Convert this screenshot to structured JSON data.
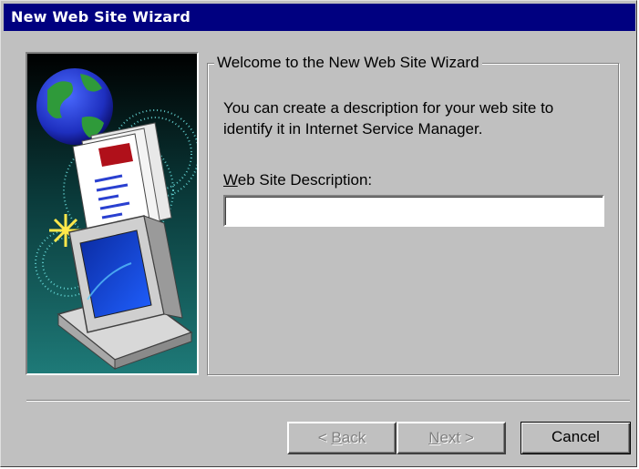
{
  "window": {
    "title": "New Web Site Wizard"
  },
  "illustration": {
    "icon": "wizard-illustration-globe-document-computer"
  },
  "group": {
    "legend": "Welcome to the New Web Site Wizard",
    "intro": "You can create a description for your web site to identify it in Internet Service Manager.",
    "field_label_accel": "W",
    "field_label_rest": "eb Site Description:",
    "field_value": ""
  },
  "buttons": {
    "back_prefix": "< ",
    "back_accel": "B",
    "back_rest": "ack",
    "next_accel": "N",
    "next_rest": "ext >",
    "cancel": "Cancel"
  },
  "colors": {
    "titlebar": "#000080",
    "dialog_face": "#c0c0c0"
  }
}
